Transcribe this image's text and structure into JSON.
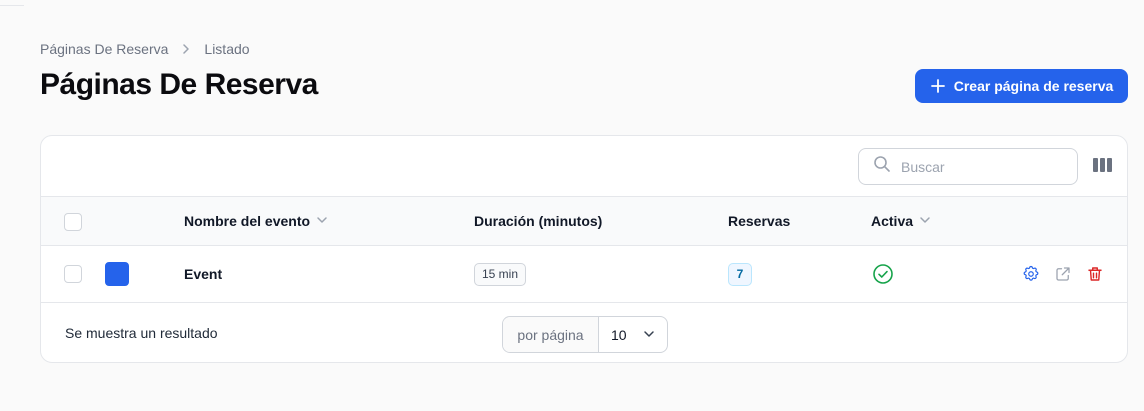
{
  "breadcrumb": {
    "parent": "Páginas De Reserva",
    "current": "Listado"
  },
  "page": {
    "title": "Páginas De Reserva"
  },
  "actions": {
    "create_label": "Crear página de reserva"
  },
  "search": {
    "placeholder": "Buscar",
    "value": ""
  },
  "table": {
    "columns": {
      "name": "Nombre del evento",
      "duration": "Duración (minutos)",
      "bookings": "Reservas",
      "active": "Activa"
    },
    "rows": [
      {
        "color": "#2563eb",
        "name": "Event",
        "duration": "15 min",
        "bookings": "7",
        "active": true
      }
    ]
  },
  "footer": {
    "result_text": "Se muestra un resultado",
    "per_page_label": "por página",
    "per_page_value": "10"
  },
  "colors": {
    "primary": "#2563eb",
    "success": "#16a34a",
    "danger": "#dc2626",
    "muted": "#9ca3af"
  },
  "icons": {
    "breadcrumb_separator": "chevron-right-icon",
    "create": "plus-icon",
    "search": "search-icon",
    "columns": "columns-icon",
    "sort": "chevron-down-icon",
    "active": "check-circle-icon",
    "settings": "gear-icon",
    "open": "external-link-icon",
    "delete": "trash-icon"
  }
}
